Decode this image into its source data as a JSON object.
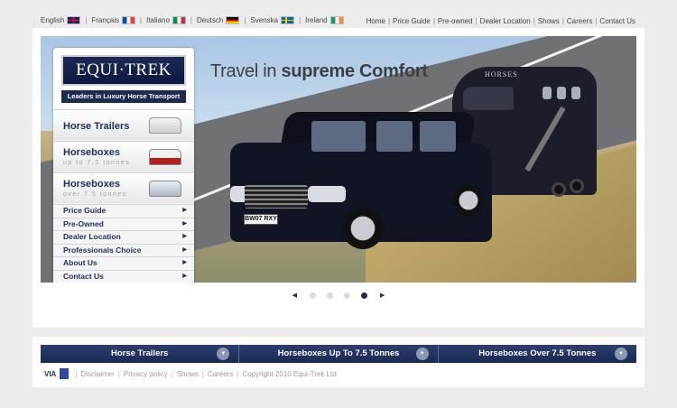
{
  "languages": [
    {
      "label": "English",
      "flag": "uk-flag-icon"
    },
    {
      "label": "Français",
      "flag": "fr-flag-icon"
    },
    {
      "label": "Italiano",
      "flag": "it-flag-icon"
    },
    {
      "label": "Deutsch",
      "flag": "de-flag-icon"
    },
    {
      "label": "Svenska",
      "flag": "se-flag-icon"
    },
    {
      "label": "Ireland",
      "flag": "ie-flag-icon"
    }
  ],
  "top_nav": [
    "Home",
    "Price Guide",
    "Pre-owned",
    "Dealer Location",
    "Shows",
    "Careers",
    "Contact Us"
  ],
  "logo": {
    "text": "EQUI·TREK",
    "tagline": "Leaders in Luxury Horse Transport"
  },
  "hero": {
    "title_regular": "Travel in ",
    "title_bold": "supreme Comfort",
    "trailer_name": "HORSES",
    "plate": "BW07 RXY"
  },
  "side_menu": {
    "main_items": [
      {
        "label": "Horse Trailers",
        "sub": ""
      },
      {
        "label": "Horseboxes",
        "sub": "up to 7.5 tonnes"
      },
      {
        "label": "Horseboxes",
        "sub": "over 7.5 tonnes"
      }
    ],
    "links": [
      "Price Guide",
      "Pre-Owned",
      "Dealer Location",
      "Professionals Choice",
      "About Us",
      "Contact Us"
    ]
  },
  "slider": {
    "count": 5,
    "active": 4
  },
  "bottom_nav": [
    "Horse Trailers",
    "Horseboxes Up To 7.5 Tonnes",
    "Horseboxes Over 7.5 Tonnes"
  ],
  "footer": {
    "badge_text": "VIA",
    "links": [
      "Disclaimer",
      "Privacy policy",
      "Shows",
      "Careers"
    ],
    "copyright": "Copyright 2010 Equi-Trek Ltd"
  },
  "colors": {
    "brand_navy": "#1d2e58",
    "nav_bar": "#1a2a55",
    "page_bg": "#ececec"
  }
}
